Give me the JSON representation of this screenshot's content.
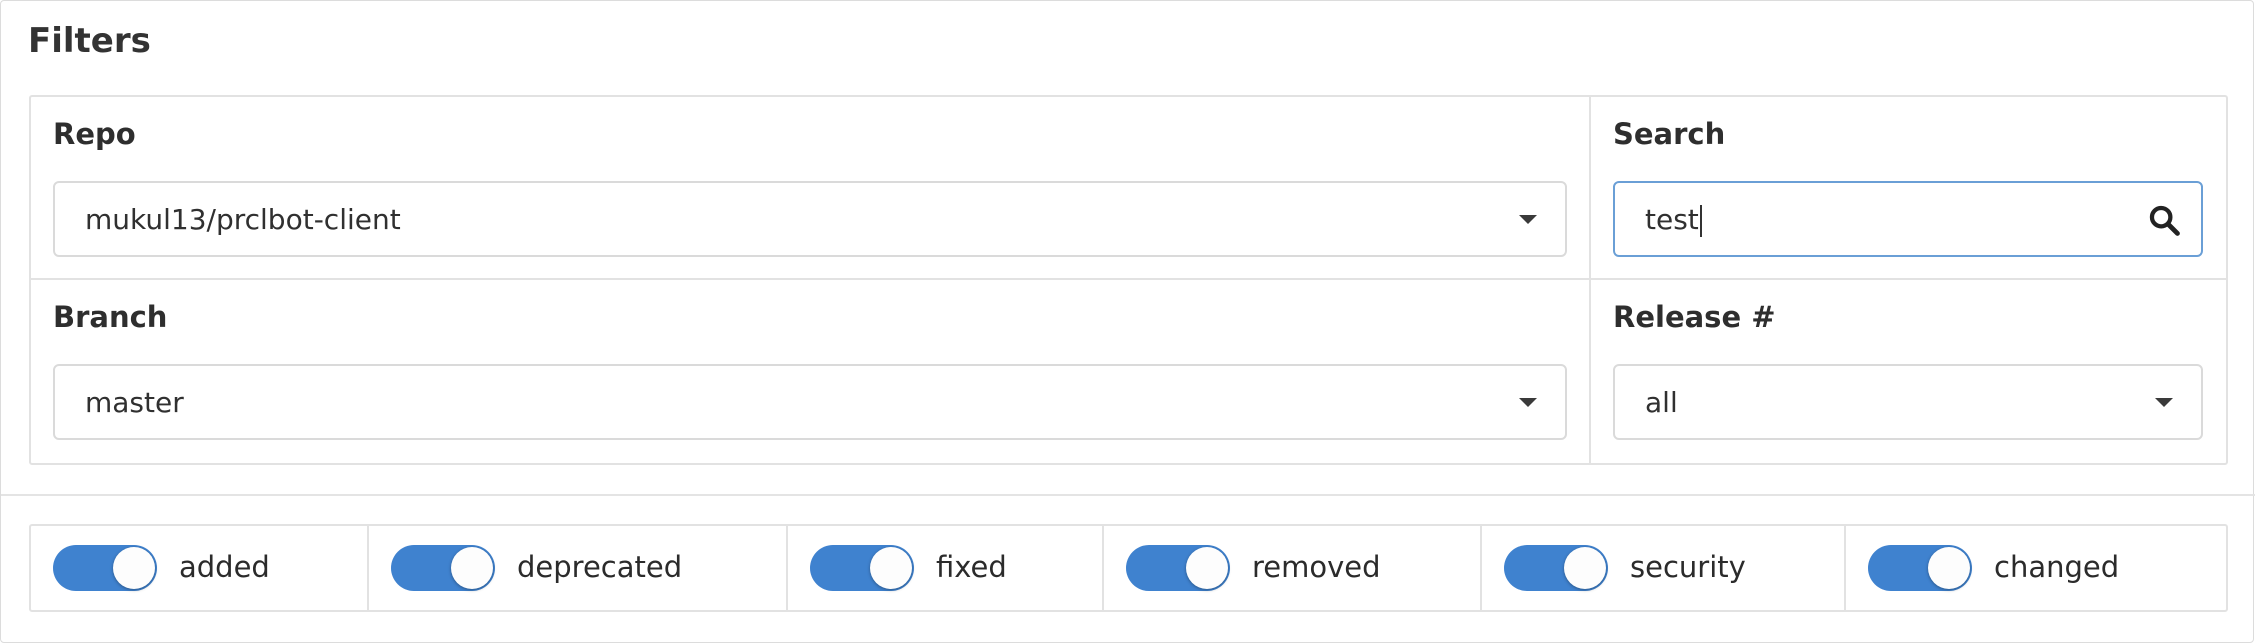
{
  "panel": {
    "title": "Filters"
  },
  "repo": {
    "label": "Repo",
    "value": "mukul13/prclbot-client"
  },
  "search": {
    "label": "Search",
    "value": "test",
    "icon": "search-icon"
  },
  "branch": {
    "label": "Branch",
    "value": "master"
  },
  "release": {
    "label": "Release #",
    "value": "all"
  },
  "toggles": [
    {
      "label": "added",
      "on": true
    },
    {
      "label": "deprecated",
      "on": true
    },
    {
      "label": "fixed",
      "on": true
    },
    {
      "label": "removed",
      "on": true
    },
    {
      "label": "security",
      "on": true
    },
    {
      "label": "changed",
      "on": true
    }
  ],
  "colors": {
    "accent": "#3f82cf",
    "focus_border": "#6a9fd6",
    "border": "#e2e2e2"
  }
}
